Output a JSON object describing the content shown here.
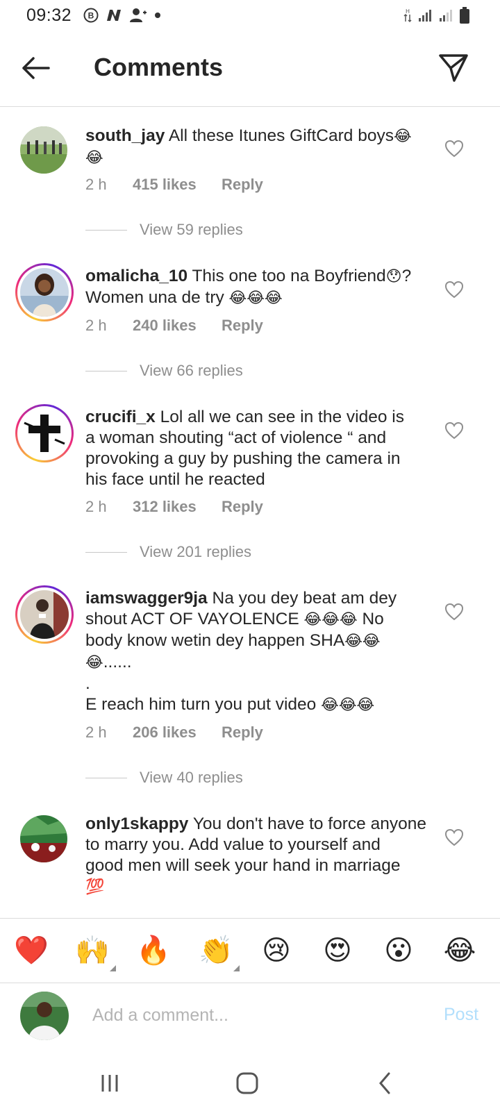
{
  "status_bar": {
    "time": "09:32",
    "left_icons": [
      "b-icon",
      "n-icon",
      "person-add-icon",
      "dot-icon"
    ],
    "right_icons": [
      "data-arrows-icon",
      "signal-icon",
      "signal-icon",
      "battery-icon"
    ]
  },
  "header": {
    "title": "Comments"
  },
  "comments": [
    {
      "username": "south_jay",
      "text": "All these Itunes GiftCard boys",
      "emoji_inline": "😂",
      "emoji_line2": "😂",
      "time": "2 h",
      "likes": "415 likes",
      "reply": "Reply",
      "view_replies": "View 59 replies",
      "has_story_ring": false
    },
    {
      "username": "omalicha_10",
      "text": "This one too na Boyfriend",
      "emoji_inline": "😯",
      "text_after": "?",
      "line2": "Women una de try",
      "emoji_line2": "😂😂😂",
      "time": "2 h",
      "likes": "240 likes",
      "reply": "Reply",
      "view_replies": "View 66 replies",
      "has_story_ring": true
    },
    {
      "username": "crucifi_x",
      "text": "Lol all we can see in the video is",
      "line2": "a woman shouting “act of violence “ and",
      "line3": "provoking a guy by pushing the camera in",
      "line4": "his face until he reacted",
      "time": "2 h",
      "likes": "312 likes",
      "reply": "Reply",
      "view_replies": "View 201 replies",
      "has_story_ring": true
    },
    {
      "username": "iamswagger9ja",
      "text": "Na you dey beat am dey",
      "line2": "shout ACT OF VAYOLENCE",
      "emoji_line2": "😂😂😂",
      "line2_after": "No",
      "line3": "body know wetin dey happen SHA",
      "emoji_line3": "😂😂",
      "emoji_line4": "😂",
      "line4_after": "......",
      "line5": ".",
      "line6": "E reach him turn you put video",
      "emoji_line6": "😂😂😂",
      "time": "2 h",
      "likes": "206 likes",
      "reply": "Reply",
      "view_replies": "View 40 replies",
      "has_story_ring": true
    },
    {
      "username": "only1skappy",
      "text": "You don't have to force anyone",
      "line2": "to marry you. Add value to yourself and",
      "line3": "good men will seek your hand in marriage",
      "emoji_line4": "💯",
      "has_story_ring": false
    }
  ],
  "emoji_bar": [
    {
      "emoji": "❤️",
      "name": "red-heart"
    },
    {
      "emoji": "🙌",
      "name": "raising-hands"
    },
    {
      "emoji": "🔥",
      "name": "fire"
    },
    {
      "emoji": "👏",
      "name": "clapping-hands"
    },
    {
      "emoji": "😢",
      "name": "crying-face"
    },
    {
      "emoji": "😍",
      "name": "heart-eyes"
    },
    {
      "emoji": "😮",
      "name": "surprised-face"
    },
    {
      "emoji": "😂",
      "name": "tears-of-joy"
    }
  ],
  "composer": {
    "placeholder": "Add a comment...",
    "post_label": "Post"
  },
  "colors": {
    "text": "#262626",
    "secondary": "#8e8e8e",
    "divider": "#dbdbdb",
    "post_disabled": "#b2dffc",
    "story_ring_start": "#f9ce34",
    "story_ring_mid": "#ee2a7b"
  },
  "nav_bar": {
    "icons": [
      "recents-icon",
      "home-icon",
      "back-icon"
    ]
  }
}
